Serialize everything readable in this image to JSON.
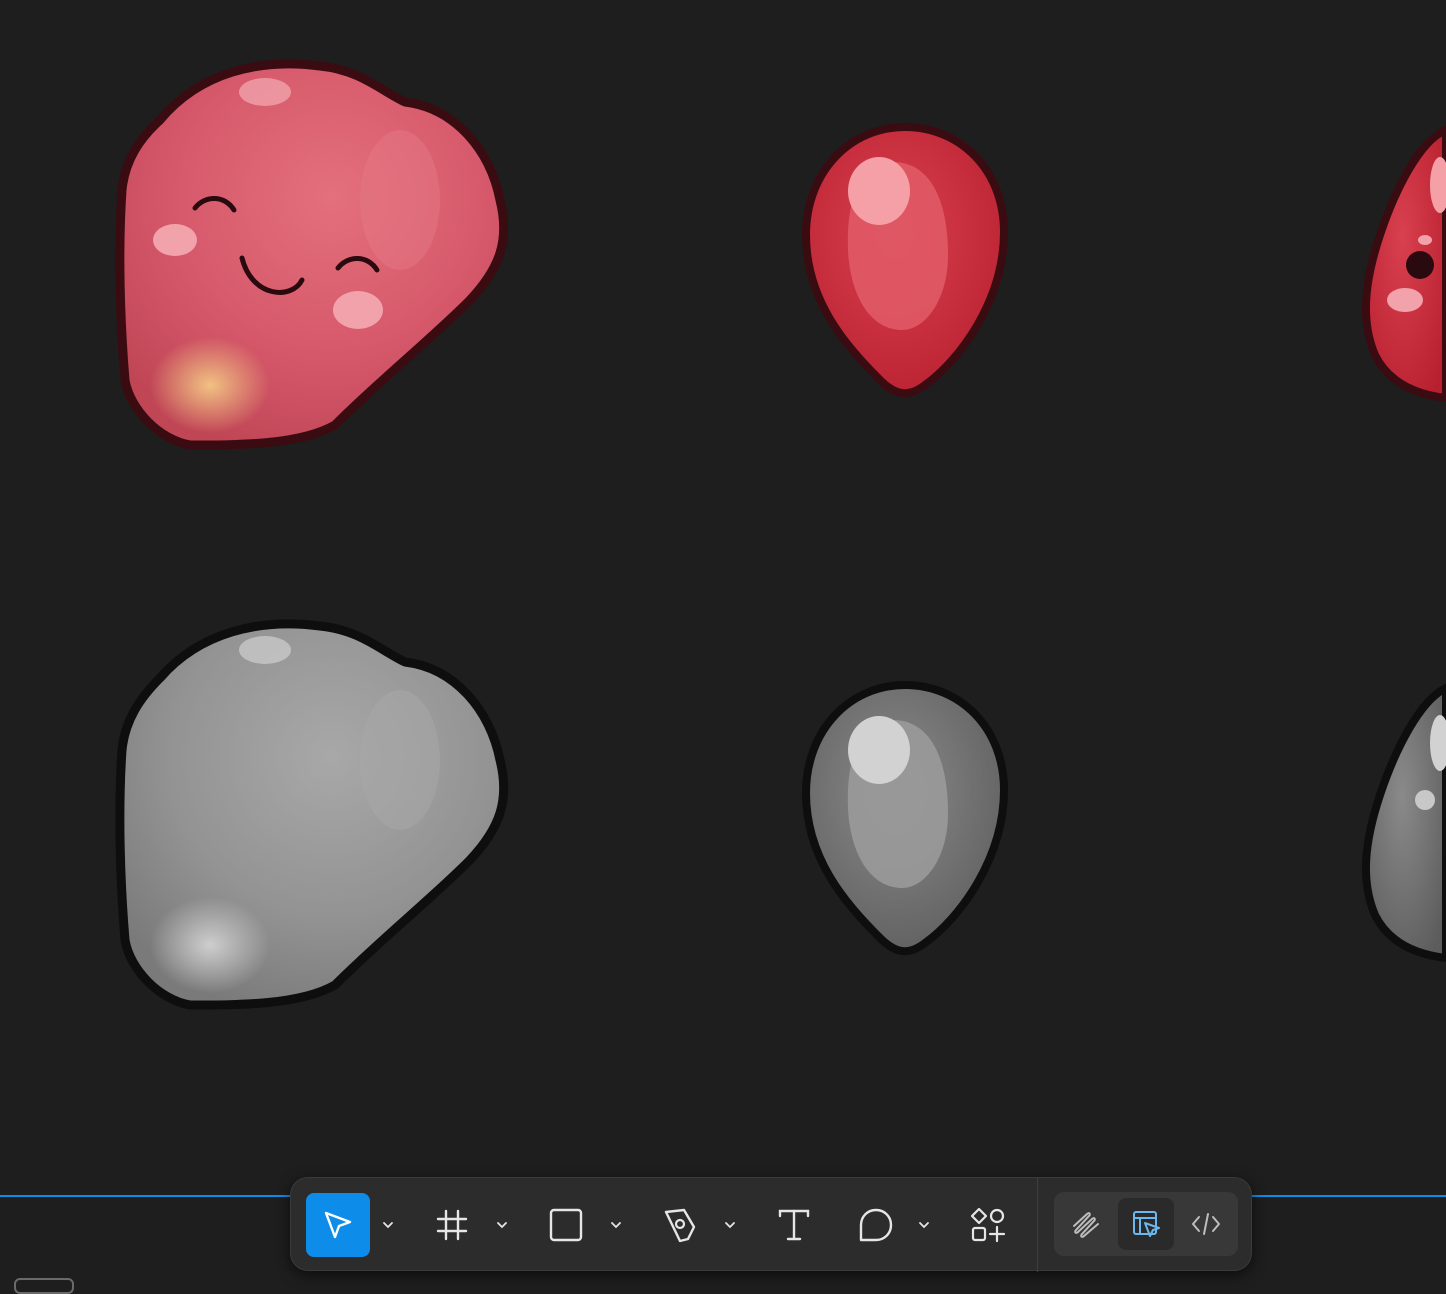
{
  "app": "Figma",
  "canvas": {
    "background": "#1e1e1e",
    "assets": [
      {
        "name": "blob-pink-smiling"
      },
      {
        "name": "drop-red"
      },
      {
        "name": "blob-red-partial"
      },
      {
        "name": "blob-gray"
      },
      {
        "name": "drop-gray"
      },
      {
        "name": "blob-gray-partial"
      }
    ]
  },
  "toolbar": {
    "tools": [
      {
        "id": "move",
        "icon": "cursor-arrow-icon",
        "active": true,
        "has_menu": true
      },
      {
        "id": "frame",
        "icon": "frame-hash-icon",
        "active": false,
        "has_menu": true
      },
      {
        "id": "shape",
        "icon": "rectangle-icon",
        "active": false,
        "has_menu": true
      },
      {
        "id": "pen",
        "icon": "pen-nib-icon",
        "active": false,
        "has_menu": true
      },
      {
        "id": "text",
        "icon": "text-T-icon",
        "active": false,
        "has_menu": false
      },
      {
        "id": "comment",
        "icon": "comment-bubble-icon",
        "active": false,
        "has_menu": true
      },
      {
        "id": "actions",
        "icon": "shapes-plus-icon",
        "active": false,
        "has_menu": false
      }
    ],
    "modes": [
      {
        "id": "draw",
        "icon": "scribble-icon",
        "active": false
      },
      {
        "id": "design",
        "icon": "design-layout-cursor-icon",
        "active": true
      },
      {
        "id": "dev",
        "icon": "code-brackets-icon",
        "active": false
      }
    ],
    "colors": {
      "accent": "#0d8ce9",
      "panel": "#2c2c2c",
      "mode_active_icon": "#6bb8f0"
    }
  }
}
